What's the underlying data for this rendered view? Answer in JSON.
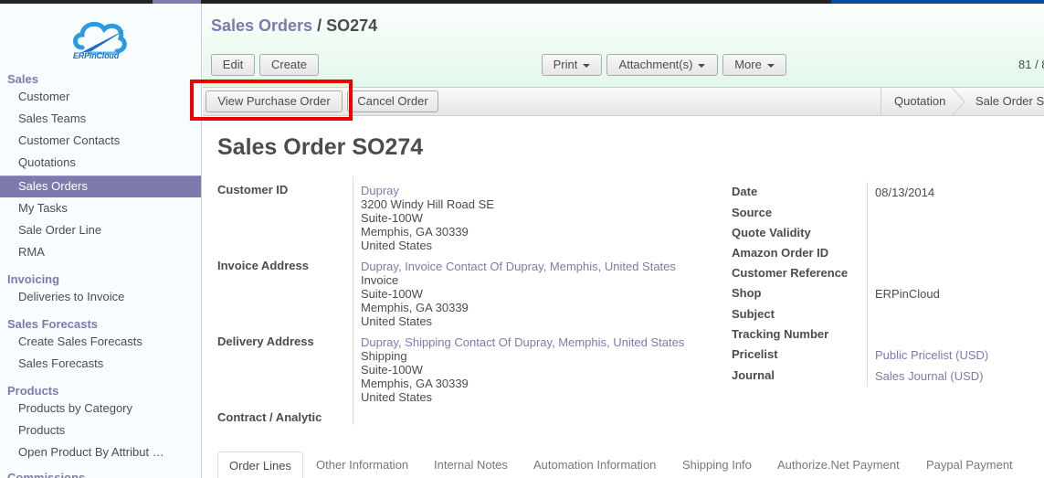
{
  "logo": {
    "text": "ERPinCloud"
  },
  "sidebar": {
    "sections": [
      {
        "label": "Sales",
        "items": [
          {
            "label": "Customer",
            "active": false
          },
          {
            "label": "Sales Teams",
            "active": false
          },
          {
            "label": "Customer Contacts",
            "active": false
          },
          {
            "label": "Quotations",
            "active": false
          },
          {
            "label": "Sales Orders",
            "active": true
          },
          {
            "label": "My Tasks",
            "active": false
          },
          {
            "label": "Sale Order Line",
            "active": false
          },
          {
            "label": "RMA",
            "active": false
          }
        ]
      },
      {
        "label": "Invoicing",
        "items": [
          {
            "label": "Deliveries to Invoice",
            "active": false
          }
        ]
      },
      {
        "label": "Sales Forecasts",
        "items": [
          {
            "label": "Create Sales Forecasts",
            "active": false
          },
          {
            "label": "Sales Forecasts",
            "active": false
          }
        ]
      },
      {
        "label": "Products",
        "items": [
          {
            "label": "Products by Category",
            "active": false
          },
          {
            "label": "Products",
            "active": false
          },
          {
            "label": "Open Product By Attribut …",
            "active": false
          }
        ]
      },
      {
        "label": "Commissions",
        "items": []
      }
    ]
  },
  "header": {
    "breadcrumb_parent": "Sales Orders",
    "breadcrumb_separator": " / ",
    "breadcrumb_current": "SO274",
    "buttons": {
      "edit": "Edit",
      "create": "Create",
      "print": "Print",
      "attachments": "Attachment(s)",
      "more": "More"
    },
    "pager": "81 / 8"
  },
  "statusbar": {
    "view_purchase_order": "View Purchase Order",
    "cancel_order": "Cancel Order",
    "stages": [
      "Quotation",
      "Sale Order S"
    ]
  },
  "form": {
    "title_prefix": "Sales Order",
    "title_number": "SO274",
    "left_fields": {
      "customer": {
        "label": "Customer ID",
        "link": "Dupray",
        "lines": [
          "3200 Windy Hill Road SE",
          "Suite-100W",
          "Memphis, GA 30339",
          "United States"
        ]
      },
      "invoice": {
        "label": "Invoice Address",
        "link": "Dupray, Invoice Contact Of Dupray, Memphis, United States",
        "lines": [
          "Invoice",
          "Suite-100W",
          "Memphis, GA 30339",
          "United States"
        ]
      },
      "delivery": {
        "label": "Delivery Address",
        "link": "Dupray, Shipping Contact Of Dupray, Memphis, United States",
        "lines": [
          "Shipping",
          "Suite-100W",
          "Memphis, GA 30339",
          "United States"
        ]
      },
      "contract": {
        "label": "Contract / Analytic",
        "value": ""
      }
    },
    "right_fields": [
      {
        "label": "Date",
        "value": "08/13/2014",
        "link": false
      },
      {
        "label": "Source",
        "value": "",
        "link": false
      },
      {
        "label": "Quote Validity",
        "value": "",
        "link": false
      },
      {
        "label": "Amazon Order ID",
        "value": "",
        "link": false
      },
      {
        "label": "Customer Reference",
        "value": "",
        "link": false
      },
      {
        "label": "Shop",
        "value": "ERPinCloud",
        "link": false
      },
      {
        "label": "Subject",
        "value": "",
        "link": false
      },
      {
        "label": "Tracking Number",
        "value": "",
        "link": false
      },
      {
        "label": "Pricelist",
        "value": "Public Pricelist (USD)",
        "link": true
      },
      {
        "label": "Journal",
        "value": "Sales Journal (USD)",
        "link": true
      }
    ]
  },
  "tabs": [
    "Order Lines",
    "Other Information",
    "Internal Notes",
    "Automation Information",
    "Shipping Info",
    "Authorize.Net Payment",
    "Paypal Payment"
  ],
  "colors": {
    "accent": "#7c7bad",
    "highlight": "#ee0000",
    "topbar_blue": "#00509e"
  }
}
